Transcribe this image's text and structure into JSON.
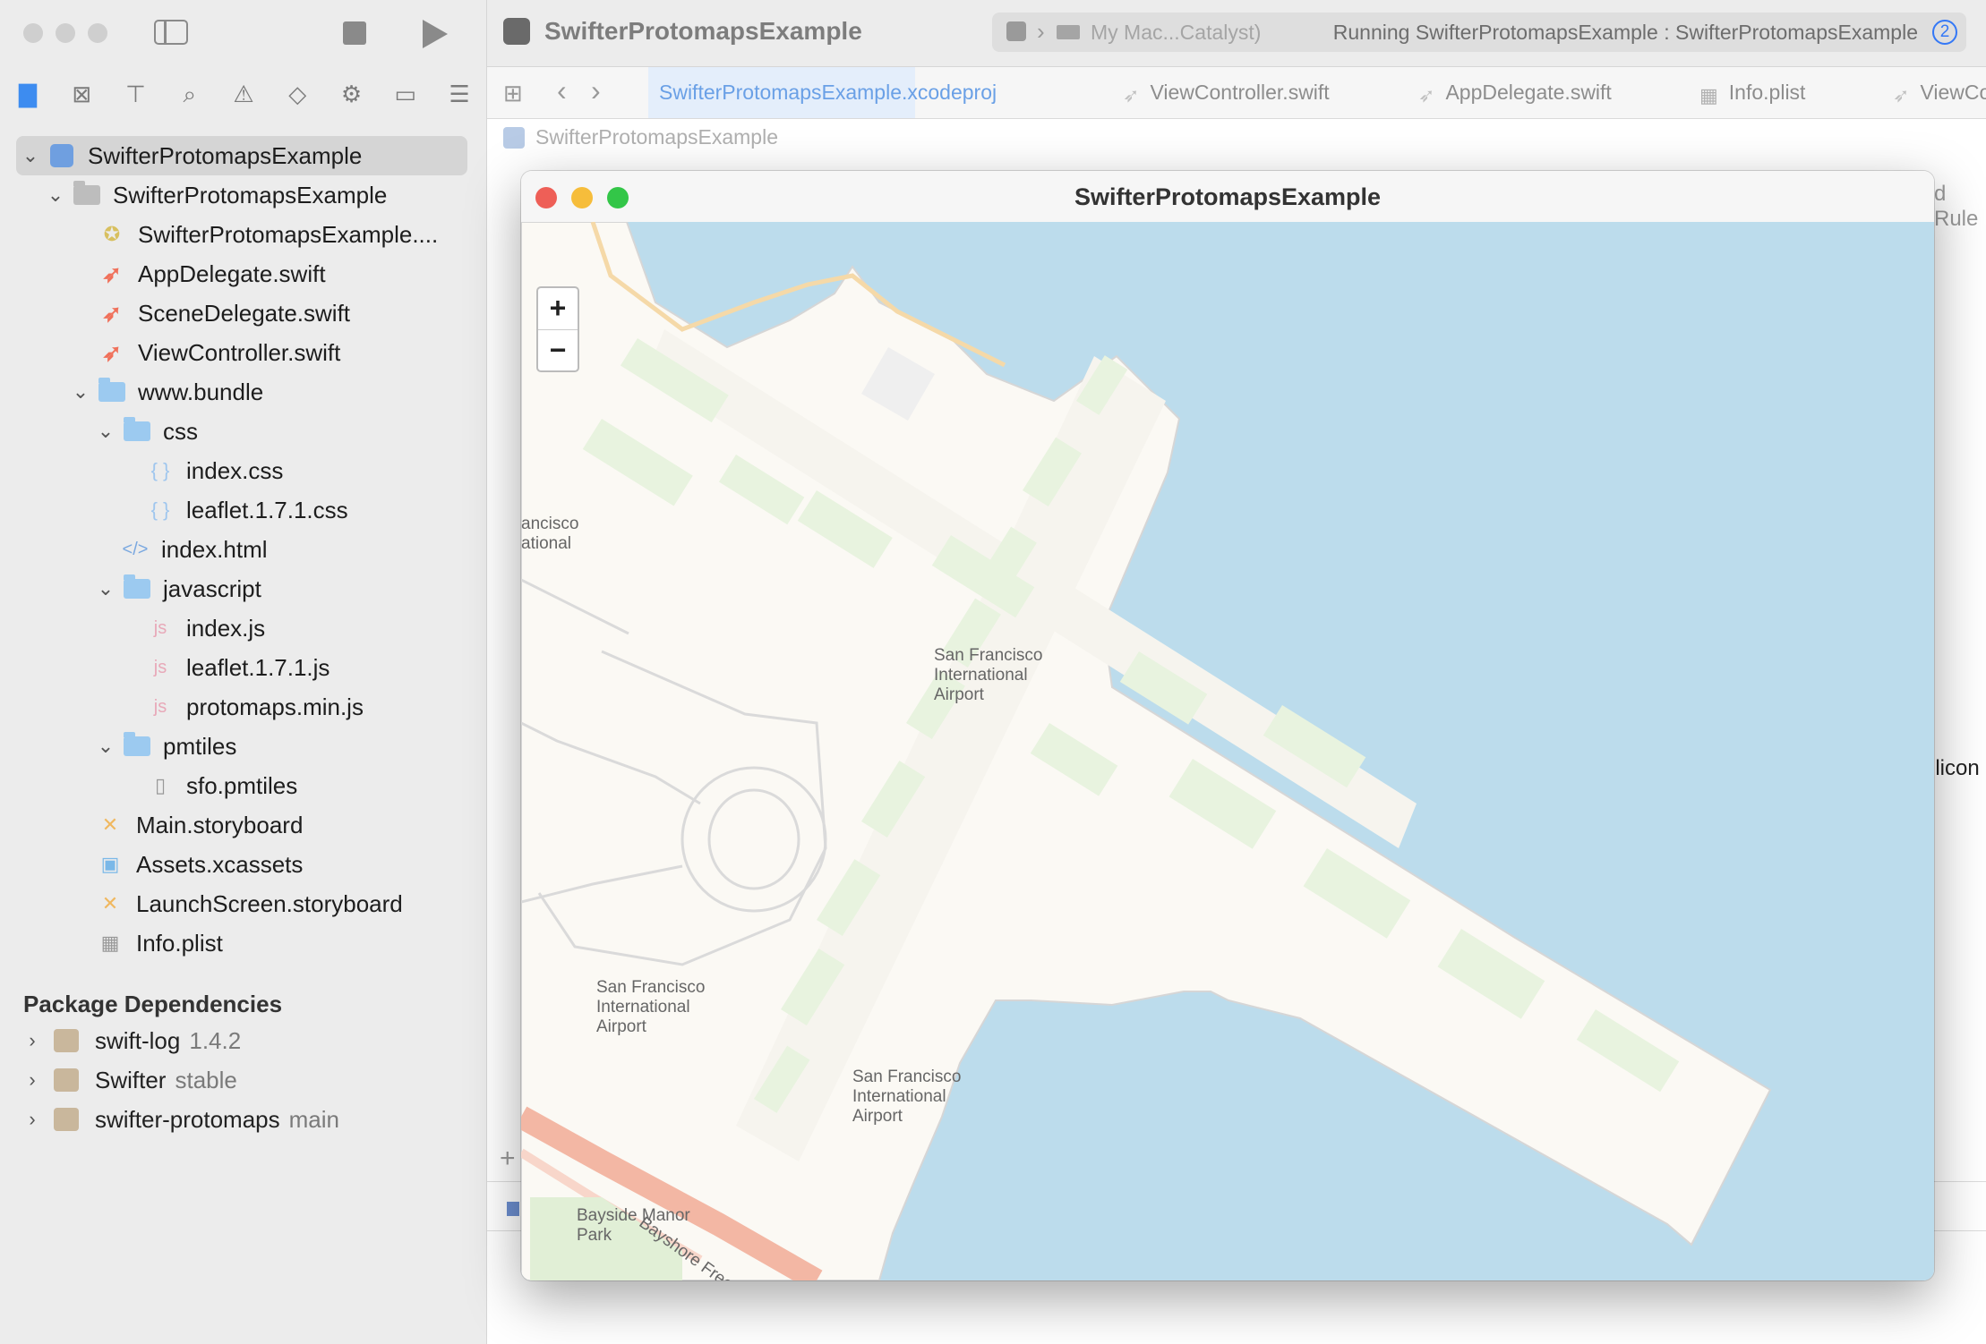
{
  "app": {
    "project_name": "SwifterProtomapsExample",
    "scheme_destination": "My Mac...Catalyst)",
    "status_text": "Running SwifterProtomapsExample : SwifterProtomapsExample",
    "issue_count": "2"
  },
  "tabs": [
    {
      "label": "SwifterProtomapsExample.xcodeproj",
      "icon": "xcodeproj-icon"
    },
    {
      "label": "ViewController.swift",
      "icon": "swift-icon"
    },
    {
      "label": "AppDelegate.swift",
      "icon": "swift-icon"
    },
    {
      "label": "Info.plist",
      "icon": "plist-icon"
    },
    {
      "label": "ViewCo",
      "icon": "swift-icon"
    }
  ],
  "breadcrumb": "SwifterProtomapsExample",
  "background_text": {
    "rules": "d Rule",
    "silicon": "ilicon"
  },
  "navigator": {
    "files": [
      {
        "label": "SwifterProtomapsExample"
      },
      {
        "label": "SwifterProtomapsExample"
      },
      {
        "label": "SwifterProtomapsExample...."
      },
      {
        "label": "AppDelegate.swift"
      },
      {
        "label": "SceneDelegate.swift"
      },
      {
        "label": "ViewController.swift"
      },
      {
        "label": "www.bundle"
      },
      {
        "label": "css"
      },
      {
        "label": "index.css"
      },
      {
        "label": "leaflet.1.7.1.css"
      },
      {
        "label": "index.html"
      },
      {
        "label": "javascript"
      },
      {
        "label": "index.js"
      },
      {
        "label": "leaflet.1.7.1.js"
      },
      {
        "label": "protomaps.min.js"
      },
      {
        "label": "pmtiles"
      },
      {
        "label": "sfo.pmtiles"
      },
      {
        "label": "Main.storyboard"
      },
      {
        "label": "Assets.xcassets"
      },
      {
        "label": "LaunchScreen.storyboard"
      },
      {
        "label": "Info.plist"
      }
    ],
    "package_header": "Package Dependencies",
    "packages": [
      {
        "name": "swift-log",
        "version": "1.4.2"
      },
      {
        "name": "Swifter",
        "version": "stable"
      },
      {
        "name": "swifter-protomaps",
        "version": "main"
      }
    ]
  },
  "window": {
    "title": "SwifterProtomapsExample",
    "zoom_in": "+",
    "zoom_out": "−"
  },
  "map_labels": {
    "sfo_line1": "San Francisco",
    "sfo_line2": "International",
    "sfo_line3": "Airport",
    "partial_line1": "ancisco",
    "partial_line2": "ational",
    "freeway": "Bayshore Freeway",
    "park_line1": "Bayside Manor",
    "park_line2": "Park"
  },
  "colors": {
    "water": "#bcdcec",
    "land": "#fbf9f4",
    "accent": "#3478f6",
    "green": "#e8f3df"
  }
}
